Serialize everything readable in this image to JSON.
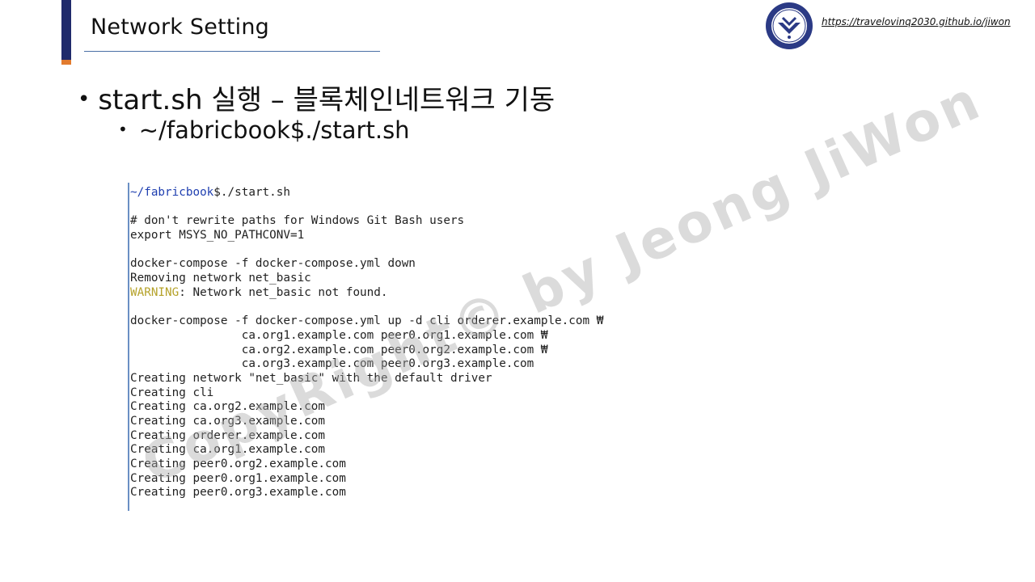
{
  "header": {
    "title": "Network Setting",
    "url": "https://travelovinq2030.github.io/jiwon"
  },
  "bullets": {
    "level1": "start.sh 실행 – 블록체인네트워크 기동",
    "level2": "~/fabricbook$./start.sh"
  },
  "terminal": {
    "prompt_path": "~/fabricbook",
    "prompt_cmd": "$./start.sh",
    "lines": [
      "",
      "# don't rewrite paths for Windows Git Bash users",
      "export MSYS_NO_PATHCONV=1",
      "",
      "docker-compose -f docker-compose.yml down",
      "Removing network net_basic",
      "",
      "",
      "docker-compose -f docker-compose.yml up -d cli orderer.example.com ₩",
      "                ca.org1.example.com peer0.org1.example.com ₩",
      "                ca.org2.example.com peer0.org2.example.com ₩",
      "                ca.org3.example.com peer0.org3.example.com",
      "Creating network \"net_basic\" with the default driver",
      "Creating cli",
      "Creating ca.org2.example.com",
      "Creating ca.org3.example.com",
      "Creating orderer.example.com",
      "Creating ca.org1.example.com",
      "Creating peer0.org2.example.com",
      "Creating peer0.org1.example.com",
      "Creating peer0.org3.example.com"
    ],
    "warning_label": "WARNING",
    "warning_text": ": Network net_basic not found."
  },
  "watermark": "CopyRight© by Jeong JiWon",
  "colors": {
    "navy": "#1f2a6b",
    "orange": "#e27b2e",
    "path_blue": "#1f3fb0",
    "warning": "#b5a22a"
  }
}
